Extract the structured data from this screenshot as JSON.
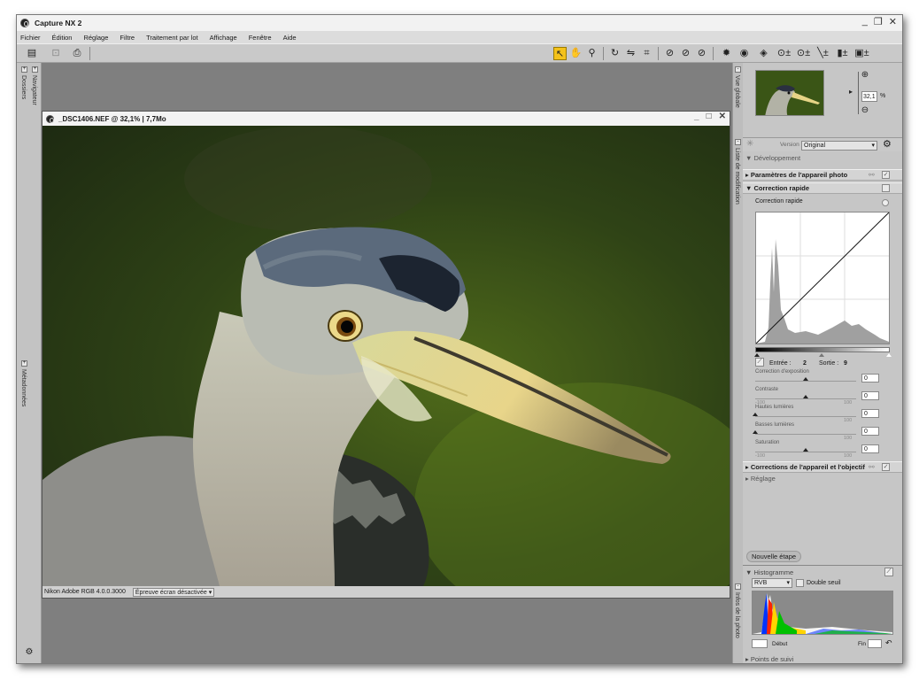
{
  "app": {
    "title": "Capture NX 2",
    "controls": [
      "_",
      "❐",
      "✕"
    ]
  },
  "menu": [
    "Fichier",
    "Édition",
    "Réglage",
    "Filtre",
    "Traitement par lot",
    "Affichage",
    "Fenêtre",
    "Aide"
  ],
  "left_tabs": {
    "folders": "Dossiers",
    "navigator": "Navigateur",
    "metadata": "Métadonnées"
  },
  "document": {
    "title": "_DSC1406.NEF @ 32,1% | 7,7Mo",
    "profile": "Nikon Adobe RGB 4.0.0.3000",
    "softproof": "Épreuve écran désactivée"
  },
  "right_tabs": {
    "overview": "Vue globale",
    "edit_list": "Liste de modification",
    "photo_info": "Infos de la photo"
  },
  "overview": {
    "zoom": "32,1",
    "unit": "%"
  },
  "edit": {
    "version_label": "Version",
    "version_value": "Original",
    "development": "Développement",
    "camera_settings": "Paramètres de l'appareil photo",
    "quick_fix": "Correction rapide",
    "quick_fix_sub": "Correction rapide",
    "input_label": "Entrée :",
    "input_value": "2",
    "output_label": "Sortie :",
    "output_value": "9",
    "sliders": [
      {
        "label": "Correction d'exposition",
        "min": "",
        "max": "",
        "value": "0",
        "level": 0.5
      },
      {
        "label": "Contraste",
        "min": "-100",
        "max": "100",
        "value": "0",
        "level": 0.5
      },
      {
        "label": "Hautes lumières",
        "min": "",
        "max": "100",
        "value": "0",
        "level": 0.0
      },
      {
        "label": "Basses lumières",
        "min": "",
        "max": "100",
        "value": "0",
        "level": 0.0
      },
      {
        "label": "Saturation",
        "min": "-100",
        "max": "100",
        "value": "0",
        "level": 0.5
      }
    ],
    "lens_corrections": "Corrections de l'appareil et l'objectif",
    "adjust": "Réglage",
    "new_step": "Nouvelle étape"
  },
  "histogram": {
    "title": "Histogramme",
    "channel": "RVB",
    "double_threshold": "Double seuil",
    "start_label": "Début",
    "end_label": "Fin"
  },
  "tracking": "Points de suivi",
  "colors": {
    "accent": "#f4c21a",
    "panel": "#c6c6c6",
    "workspace": "#7f7f7f"
  }
}
